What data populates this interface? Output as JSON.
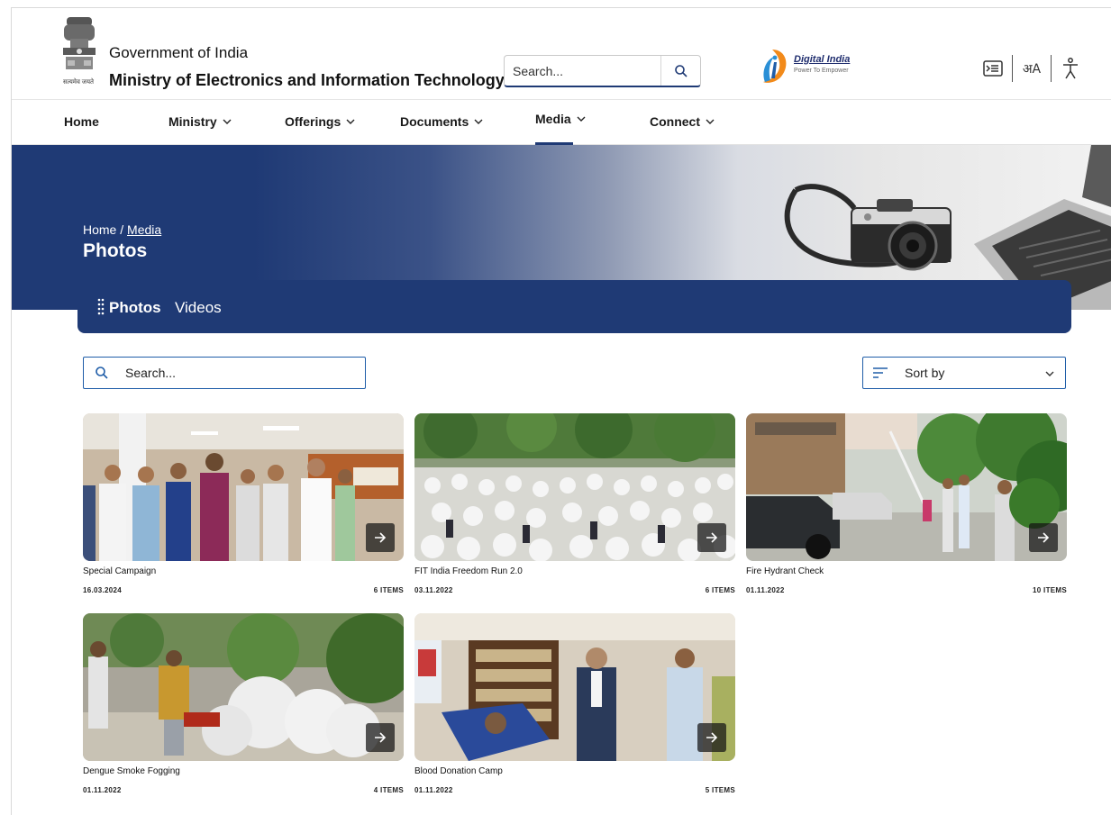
{
  "header": {
    "emblem_caption": "सत्यमेव जयते",
    "gov_title": "Government of India",
    "ministry_title": "Ministry of Electronics and Information Technology",
    "search_placeholder": "Search...",
    "digital_india_title": "Digital India",
    "digital_india_tagline": "Power To Empower",
    "tool_language_label": "अA"
  },
  "nav": {
    "items": [
      {
        "label": "Home"
      },
      {
        "label": "Ministry"
      },
      {
        "label": "Offerings"
      },
      {
        "label": "Documents"
      },
      {
        "label": "Media"
      },
      {
        "label": "Connect"
      }
    ],
    "active": "Media"
  },
  "banner": {
    "breadcrumb_home": "Home",
    "breadcrumb_sep": " / ",
    "breadcrumb_current": "Media",
    "title": "Photos"
  },
  "tabs": [
    {
      "label": "Photos",
      "active": true
    },
    {
      "label": "Videos",
      "active": false
    }
  ],
  "filters": {
    "search_placeholder": "Search...",
    "sort_label": "Sort by"
  },
  "albums": [
    {
      "title": "Special Campaign",
      "date": "16.03.2024",
      "count": "6 ITEMS"
    },
    {
      "title": "FIT India Freedom Run 2.0",
      "date": "03.11.2022",
      "count": "6 ITEMS"
    },
    {
      "title": "Fire Hydrant Check",
      "date": "01.11.2022",
      "count": "10 ITEMS"
    },
    {
      "title": "Dengue Smoke Fogging",
      "date": "01.11.2022",
      "count": "4 ITEMS"
    },
    {
      "title": "Blood Donation Camp",
      "date": "01.11.2022",
      "count": "5 ITEMS"
    }
  ],
  "colors": {
    "brand_navy": "#1f3a75",
    "input_border": "#1f5da8"
  }
}
